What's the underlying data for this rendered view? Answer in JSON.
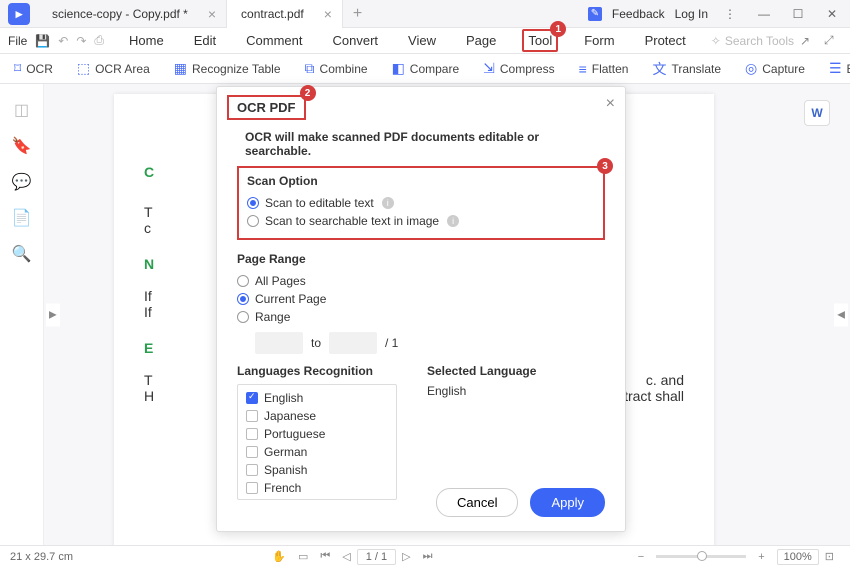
{
  "titlebar": {
    "tabs": [
      {
        "title": "science-copy - Copy.pdf *"
      },
      {
        "title": "contract.pdf"
      }
    ],
    "feedback": "Feedback",
    "login": "Log In"
  },
  "menubar": {
    "file": "File",
    "items": [
      "Home",
      "Edit",
      "Comment",
      "Convert",
      "View",
      "Page",
      "Tool",
      "Form",
      "Protect"
    ],
    "search_placeholder": "Search Tools"
  },
  "toolbar": {
    "items": [
      "OCR",
      "OCR Area",
      "Recognize Table",
      "Combine",
      "Compare",
      "Compress",
      "Flatten",
      "Translate",
      "Capture",
      "Ba"
    ]
  },
  "dialog": {
    "title": "OCR PDF",
    "desc": "OCR will make scanned PDF documents editable or searchable.",
    "scan_option": {
      "title": "Scan Option",
      "opt1": "Scan to editable text",
      "opt2": "Scan to searchable text in image"
    },
    "page_range": {
      "title": "Page Range",
      "all": "All Pages",
      "current": "Current Page",
      "range": "Range",
      "to": "to",
      "total": "/ 1"
    },
    "lang_title": "Languages Recognition",
    "sel_title": "Selected Language",
    "sel_value": "English",
    "langs": [
      "English",
      "Japanese",
      "Portuguese",
      "German",
      "Spanish",
      "French"
    ],
    "cancel": "Cancel",
    "apply": "Apply"
  },
  "statusbar": {
    "dims": "21 x 29.7 cm",
    "page": "1 / 1",
    "zoom": "100%"
  },
  "badges": {
    "b1": "1",
    "b2": "2",
    "b3": "3"
  },
  "doc_snippets": {
    "c1": "C",
    "t1": "T",
    "c2": "c",
    "n1": "N",
    "i1": "If",
    "i2": "If",
    "e1": "E",
    "t2": "T",
    "h1": "H",
    "tail": "c. and",
    "tail2": "ntract shall"
  }
}
